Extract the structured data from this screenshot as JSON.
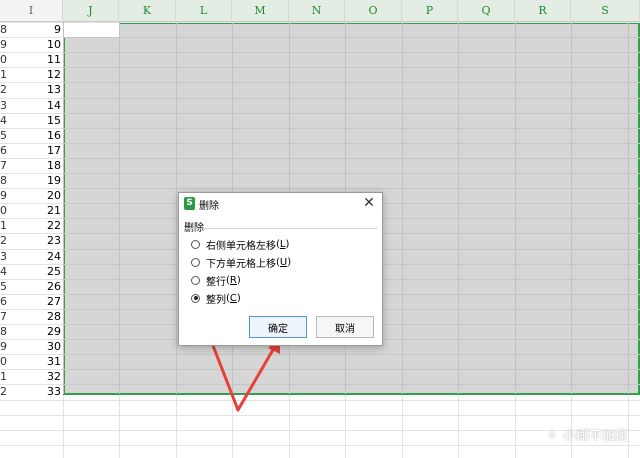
{
  "columns": [
    "I",
    "J",
    "K",
    "L",
    "M",
    "N",
    "O",
    "P",
    "Q",
    "R",
    "S"
  ],
  "row_labels": [
    "8",
    "9",
    "0",
    "1",
    "2",
    "3",
    "4",
    "5",
    "6",
    "7",
    "8",
    "9",
    "0",
    "1",
    "2",
    "3",
    "4",
    "5",
    "6",
    "7",
    "8",
    "9",
    "0",
    "1",
    "2"
  ],
  "column_i_values": [
    "9",
    "10",
    "11",
    "12",
    "13",
    "14",
    "15",
    "16",
    "17",
    "18",
    "19",
    "20",
    "21",
    "22",
    "23",
    "24",
    "25",
    "26",
    "27",
    "28",
    "29",
    "30",
    "31",
    "32",
    "33"
  ],
  "dialog": {
    "title": "删除",
    "icon_letter": "S",
    "close": "✕",
    "group_label": "删除",
    "options": [
      {
        "label": "右侧单元格左移",
        "key": "L",
        "selected": false
      },
      {
        "label": "下方单元格上移",
        "key": "U",
        "selected": false
      },
      {
        "label": "整行",
        "key": "R",
        "selected": false
      },
      {
        "label": "整列",
        "key": "C",
        "selected": true
      }
    ],
    "ok_label": "确定",
    "cancel_label": "取消"
  },
  "watermark": {
    "text": "小椰不加班",
    "icon": "circle-logo-icon"
  },
  "colors": {
    "selection_border": "#35a04a",
    "selection_fill": "#d6d6d6",
    "arrow": "#e8403a"
  }
}
